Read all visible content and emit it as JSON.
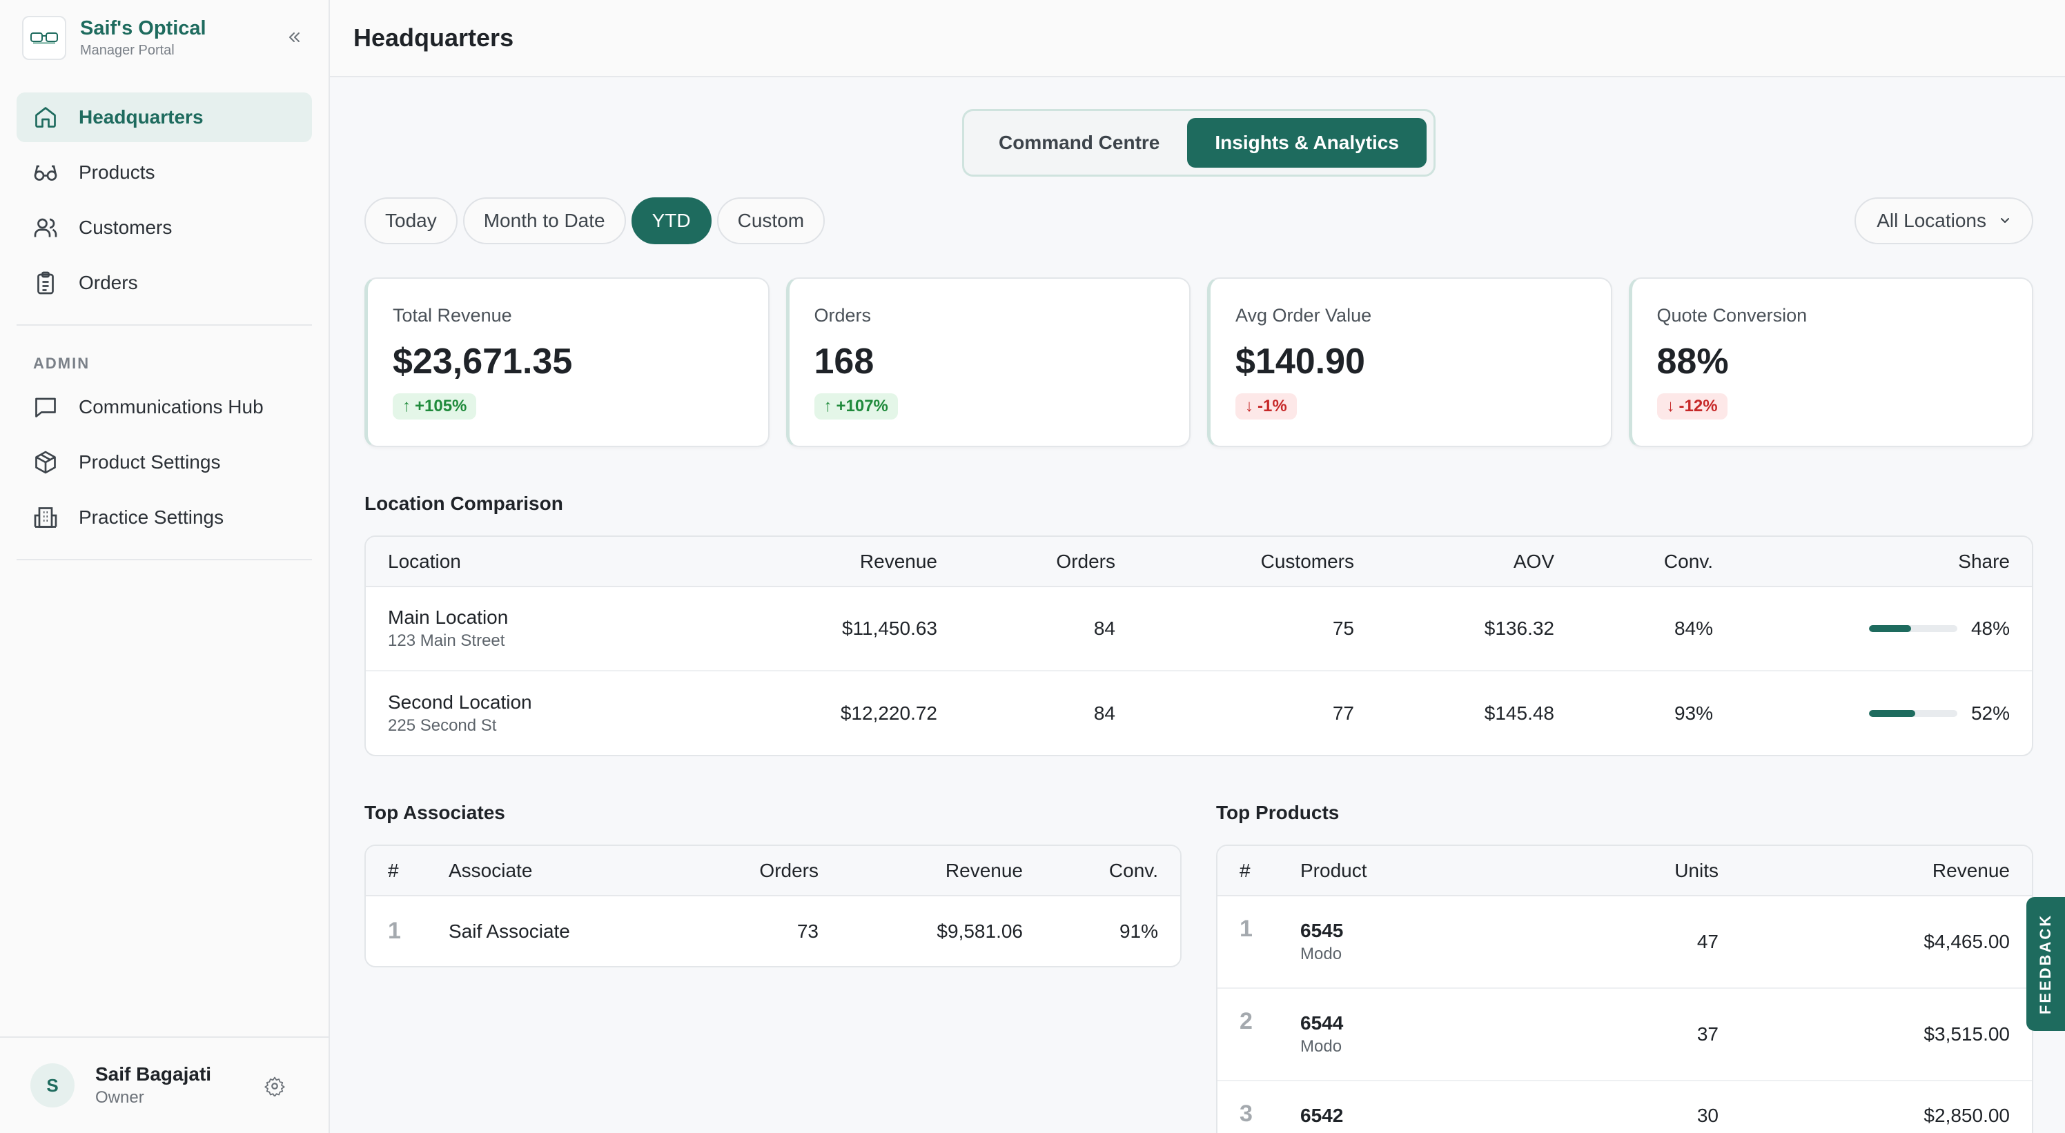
{
  "brand": {
    "name": "Saif's Optical",
    "subtitle": "Manager Portal"
  },
  "sidebar": {
    "items": [
      {
        "label": "Headquarters",
        "icon": "home-icon",
        "active": true
      },
      {
        "label": "Products",
        "icon": "glasses-icon",
        "active": false
      },
      {
        "label": "Customers",
        "icon": "users-icon",
        "active": false
      },
      {
        "label": "Orders",
        "icon": "clipboard-icon",
        "active": false
      }
    ],
    "admin_label": "ADMIN",
    "admin_items": [
      {
        "label": "Communications Hub",
        "icon": "message-icon"
      },
      {
        "label": "Product Settings",
        "icon": "box-icon"
      },
      {
        "label": "Practice Settings",
        "icon": "building-icon"
      }
    ]
  },
  "user": {
    "initial": "S",
    "name": "Saif Bagajati",
    "role": "Owner"
  },
  "header": {
    "title": "Headquarters"
  },
  "view_toggle": {
    "options": [
      "Command Centre",
      "Insights & Analytics"
    ],
    "selected": "Insights & Analytics"
  },
  "date_filters": {
    "options": [
      "Today",
      "Month to Date",
      "YTD",
      "Custom"
    ],
    "selected": "YTD"
  },
  "location_select": {
    "value": "All Locations"
  },
  "kpis": [
    {
      "label": "Total Revenue",
      "value": "$23,671.35",
      "change": "+105%",
      "direction": "up"
    },
    {
      "label": "Orders",
      "value": "168",
      "change": "+107%",
      "direction": "up"
    },
    {
      "label": "Avg Order Value",
      "value": "$140.90",
      "change": "-1%",
      "direction": "down"
    },
    {
      "label": "Quote Conversion",
      "value": "88%",
      "change": "-12%",
      "direction": "down"
    }
  ],
  "location_comparison": {
    "title": "Location Comparison",
    "columns": [
      "Location",
      "Revenue",
      "Orders",
      "Customers",
      "AOV",
      "Conv.",
      "Share"
    ],
    "rows": [
      {
        "name": "Main Location",
        "address": "123 Main Street",
        "revenue": "$11,450.63",
        "orders": "84",
        "customers": "75",
        "aov": "$136.32",
        "conv": "84%",
        "share": "48%",
        "share_value": 0.48
      },
      {
        "name": "Second Location",
        "address": "225 Second St",
        "revenue": "$12,220.72",
        "orders": "84",
        "customers": "77",
        "aov": "$145.48",
        "conv": "93%",
        "share": "52%",
        "share_value": 0.52
      }
    ]
  },
  "top_associates": {
    "title": "Top Associates",
    "columns": [
      "#",
      "Associate",
      "Orders",
      "Revenue",
      "Conv."
    ],
    "rows": [
      {
        "rank": "1",
        "name": "Saif Associate",
        "orders": "73",
        "revenue": "$9,581.06",
        "conv": "91%"
      }
    ]
  },
  "top_products": {
    "title": "Top Products",
    "columns": [
      "#",
      "Product",
      "Units",
      "Revenue"
    ],
    "rows": [
      {
        "rank": "1",
        "product": "6545",
        "brand": "Modo",
        "units": "47",
        "revenue": "$4,465.00"
      },
      {
        "rank": "2",
        "product": "6544",
        "brand": "Modo",
        "units": "37",
        "revenue": "$3,515.00"
      },
      {
        "rank": "3",
        "product": "6542",
        "brand": "",
        "units": "30",
        "revenue": "$2,850.00"
      }
    ]
  },
  "feedback_label": "FEEDBACK",
  "colors": {
    "accent": "#1e6b5e",
    "up": "#1f8a3b",
    "down": "#c62828"
  }
}
